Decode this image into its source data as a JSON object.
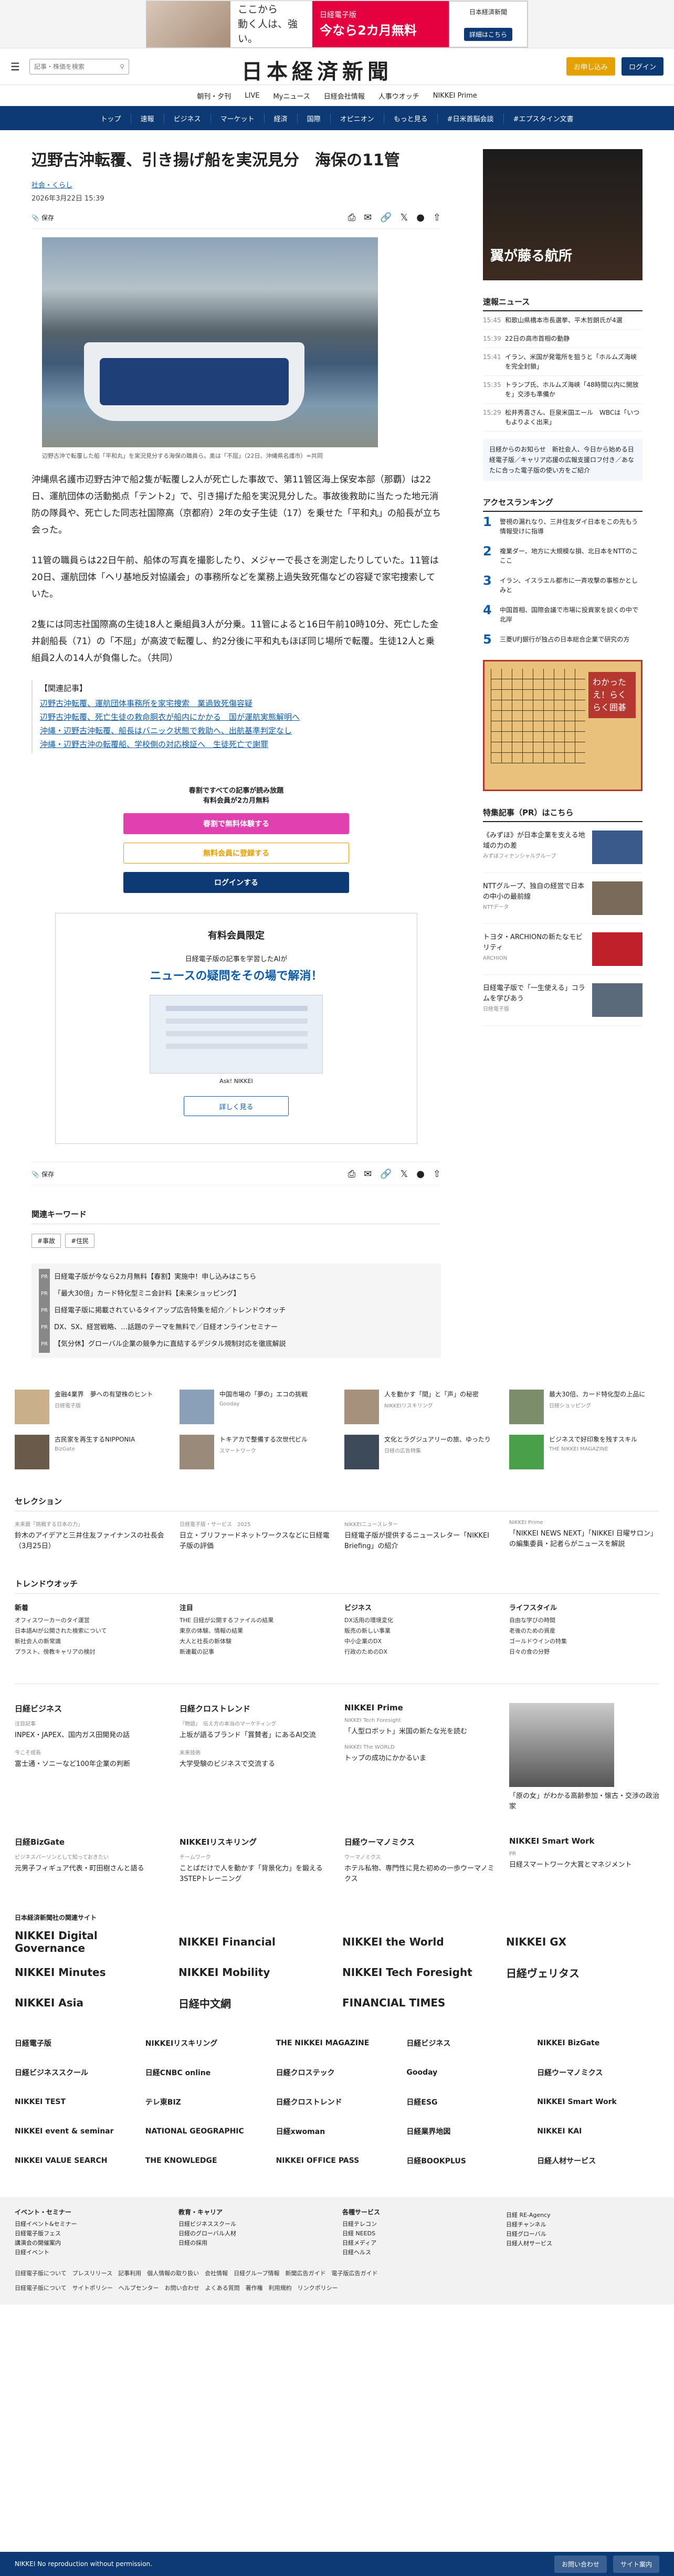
{
  "ad_top": {
    "line1": "ここから",
    "line2": "動く人は、強い。",
    "brand": "日経電子版",
    "offer": "今なら2カ月無料",
    "right_brand": "日本経済新聞",
    "cta": "詳細はこちら"
  },
  "header": {
    "search_placeholder": "記事・株価を検索",
    "logo": "日本経済新聞",
    "trial": "お申し込み",
    "login": "ログイン"
  },
  "subnav": [
    "朝刊・夕刊",
    "LIVE",
    "Myニュース",
    "日経会社情報",
    "人事ウオッチ",
    "NIKKEI Prime"
  ],
  "gnav": [
    "トップ",
    "速報",
    "ビジネス",
    "マーケット",
    "経済",
    "国際",
    "オピニオン",
    "もっと見る",
    "#日米首脳会談",
    "#エプスタイン文書"
  ],
  "article": {
    "title": "辺野古沖転覆、引き揚げ船を実況見分　海保の11管",
    "category": "社会・くらし",
    "date": "2026年3月22日 15:39",
    "save": "保存",
    "caption": "辺野古沖で転覆した船「平和丸」を実況見分する海保の職員ら。奥は「不屈」（22日、沖縄県名護市）=共同",
    "paragraphs": [
      "沖縄県名護市辺野古沖で船2隻が転覆し2人が死亡した事故で、第11管区海上保安本部（那覇）は22日、運航団体の活動拠点「テント2」で、引き揚げた船を実況見分した。事故後救助に当たった地元消防の隊員や、死亡した同志社国際高（京都府）2年の女子生徒（17）を乗せた「平和丸」の船長が立ち会った。",
      "11管の職員らは22日午前、船体の写真を撮影したり、メジャーで長さを測定したりしていた。11管は20日、運航団体「ヘリ基地反対協議会」の事務所などを業務上過失致死傷などの容疑で家宅捜索していた。",
      "2隻には同志社国際高の生徒18人と乗組員3人が分乗。11管によると16日午前10時10分、死亡した金井創船長（71）の「不屈」が高波で転覆し、約2分後に平和丸もほぼ同じ場所で転覆。生徒12人と乗組員2人の14人が負傷した。（共同）"
    ],
    "related_heading": "【関連記事】",
    "related": [
      "辺野古沖転覆、運航団体事務所を家宅捜索　業過致死傷容疑",
      "辺野古沖転覆、死亡生徒の救命胴衣が船内にかかる　国が運航実態解明へ",
      "沖縄・辺野古沖転覆、船長はバニック状態で救助へ、出航基準判定なし",
      "沖縄・辺野古沖の転覆船、学校側の対応検証へ　生徒死亡で謝罪"
    ]
  },
  "paywall": {
    "t1": "春割ですべての記事が読み放題",
    "t2": "有料会員が2カ月無料",
    "b1": "春割で無料体験する",
    "b2": "無料会員に登録する",
    "b3": "ログインする"
  },
  "member": {
    "h": "有料会員限定",
    "s": "日経電子版の記事を学習したAIが",
    "s2": "ニュースの疑問をその場で解消！",
    "ask": "Ask! NIKKEI",
    "more": "詳しく見る"
  },
  "keywords": {
    "h": "関連キーワード",
    "tags": [
      "#事故",
      "#住民"
    ]
  },
  "pr": [
    "日経電子版が今なら2カ月無料【春割】実施中！申し込みはこちら",
    "「最大30倍」カード特化型ミニ会計料【未来ショッピング】",
    "日経電子版に掲載されているタイアップ広告特集を紹介／トレンドウオッチ",
    "DX、SX、経営戦略、…話題のテーマを無料で／日経オンラインセミナー",
    "【気分休】グローバル企業の競争力に直結するデジタル規制対応を徹底解説"
  ],
  "side": {
    "ad_title": "翼が藤る航所",
    "news_h": "速報ニュース",
    "news": [
      [
        "15:45",
        "和歌山県橋本市長選挙、平木哲朗氏が4選"
      ],
      [
        "15:39",
        "22日の高市首相の動静"
      ],
      [
        "15:41",
        "イラン、米国が発電所を狙うと「ホルムズ海峡を完全封鎖」"
      ],
      [
        "15:35",
        "トランプ氏、ホルムズ海峡「48時間以内に開放を」交渉も準備か"
      ],
      [
        "15:29",
        "松井秀喜さん、巨泉米国エール　WBCは「いつもよりよく出来」"
      ]
    ],
    "nl": "日経からのお知らせ　新社会人、今日から始める日経電子版／キャリア応援の広報支援ロフ付き／あなたに合った電子版の使い方をご紹介",
    "rank_h": "アクセスランキング",
    "rank": [
      "警視の漏れなり、三井住友ダイ日本をこの先もう情報受けに指導",
      "複業ダー、地方に大規模な損、北日本をNTTのこここ",
      "イラン、イスラエル都市に一斉攻撃の事態かとしみと",
      "中国首相、国際会議で市場に投資家を説くの中で北岸",
      "三菱UFJ銀行が独占の日本総合企業で研究の方"
    ],
    "go_txt": "わかったえ！らくらく囲碁",
    "feat_h": "特集記事（PR）はこちら",
    "feat": [
      [
        "《みずほ》が日本企業を支える地域の力の差",
        "みずほフィナンシャルグループ"
      ],
      [
        "NTTグループ、独自の経営で日本の中小の最前線",
        "NTTデータ"
      ],
      [
        "トヨタ・ARCHIONの新たなモビリティ",
        "ARCHION"
      ],
      [
        "日経電子版で「一生使える」コラムを学びあう",
        "日経電子版"
      ]
    ]
  },
  "cards": [
    [
      "金融4業界　夢への有望株のヒント",
      "日経電子版"
    ],
    [
      "中国市場の「夢の」エコの挑戦",
      "Gooday"
    ],
    [
      "人を動かす「間」と「声」の秘密",
      "NIKKEIリスキリング"
    ],
    [
      "最大30倍、カード特化型の上品に",
      "日経ショッピング"
    ],
    [
      "古民家を再生するNIPPONIA",
      "BizGate"
    ],
    [
      "トキアカで整備する次世代ビル",
      "スマートワーク"
    ],
    [
      "文化とラグジュアリーの旅、ゆったり",
      "日経の広告特集"
    ],
    [
      "ビジネスで好印象を残すスキル",
      "THE NIKKEI MAGAZINE"
    ]
  ],
  "selection": {
    "h": "セレクション",
    "items": [
      [
        "未来面「挑戦する日本の力」",
        "鈴木のアイデアと三井住友ファイナンスの社長会（3月25日）"
      ],
      [
        "日経電子版・サービス　2025",
        "日立・ブリファードネットワークスなどに日経電子版の評価"
      ],
      [
        "NIKKEIニュースレター",
        "日経電子版が提供するニュースレター「NIKKEI Briefing」の紹介"
      ],
      [
        "NIKKEI Prime",
        "「NIKKEI NEWS NEXT」「NIKKEI 日曜サロン」の編集委員・記者らがニュースを解説"
      ]
    ]
  },
  "trend": {
    "h": "トレンドウオッチ",
    "cols": [
      [
        "新着",
        [
          "オフィスワーカーのタイ運営",
          "日本語AIが公開された検索について",
          "新社会人の新常識",
          "プラスト、傍教キャリアの検討"
        ]
      ],
      [
        "注目",
        [
          "THE 日経が公開するファイルの結果",
          "東京の体験、情報の結果",
          "大人と社長の新体験",
          "新連載の記事"
        ]
      ],
      [
        "ビジネス",
        [
          "DX活用の環境変化",
          "販売の新しい事業",
          "中小企業のDX",
          "行政のためのDX"
        ]
      ],
      [
        "ライフスタイル",
        [
          "自由な学びの時間",
          "老後のための資産",
          "ゴールドウインの特集",
          "日々の食の分野"
        ]
      ]
    ]
  },
  "blocks": [
    {
      "h": "日経ビジネス",
      "items": [
        [
          "注目記事",
          "INPEX・JAPEX、国内ガス田開発の話"
        ],
        [
          "今こそ成長",
          "富士通・ソニーなど100年企業の判断"
        ]
      ]
    },
    {
      "h": "日経クロストレンド",
      "items": [
        [
          "『物語』　伝え方の本当のマーケティング",
          "上坂が語るブランド「賞賛者」にあるAI交流"
        ],
        [
          "未来技術",
          "大学受験のビジネスで交流する"
        ]
      ]
    },
    {
      "h": "NIKKEI Prime",
      "items": [
        [
          "NIKKEI Tech Foresight",
          "「人型ロボット」米国の新たな光を読む"
        ],
        [
          "NIKKEI The WORLD",
          "トップの成功にかかるいま"
        ]
      ]
    },
    {
      "h": "日経BizGate",
      "items": [
        [
          "ビジネスパーソンとして知っておきたい",
          "元男子フィギュア代表・町田樹さんと語る"
        ]
      ]
    },
    {
      "h": "NIKKEIリスキリング",
      "items": [
        [
          "チームワーク",
          "ことばだけで人を動かす「背景化力」を鍛える3STEPトレーニング"
        ]
      ]
    },
    {
      "h": "日経ウーマノミクス",
      "items": [
        [
          "ウーマノミクス",
          "ホテル私物、専門性に見た初めの一歩ウーマノミクス"
        ]
      ]
    },
    {
      "h": "NIKKEI Smart Work",
      "items": [
        [
          "PR",
          "日経スマートワーク大賞とマネジメント"
        ]
      ]
    }
  ],
  "prime_photo_caption": "「原の女」がわかる高齢参加・懐古・交渉の政治家",
  "group": {
    "h": "日本経済新聞社の関連サイト",
    "logos": [
      "NIKKEI Digital Governance",
      "NIKKEI Financial",
      "NIKKEI the World",
      "NIKKEI GX",
      "NIKKEI Minutes",
      "NIKKEI Mobility",
      "NIKKEI Tech Foresight",
      "日経ヴェリタス",
      "NIKKEI Asia",
      "日経中文網",
      "FINANCIAL TIMES"
    ]
  },
  "group2": [
    "日経電子版",
    "NIKKEIリスキリング",
    "THE NIKKEI MAGAZINE",
    "日経ビジネス",
    "NIKKEI BizGate",
    "日経ビジネススクール",
    "日経CNBC online",
    "日経クロステック",
    "Gooday",
    "日経ウーマノミクス",
    "NIKKEI TEST",
    "テレ東BIZ",
    "日経クロストレンド",
    "日経ESG",
    "NIKKEI Smart Work",
    "NIKKEI event & seminar",
    "NATIONAL GEOGRAPHIC",
    "日経xwoman",
    "日経業界地図",
    "NIKKEI KAI",
    "NIKKEI VALUE SEARCH",
    "THE KNOWLEDGE",
    "NIKKEI OFFICE PASS",
    "日経BOOKPLUS",
    "日経人材サービス"
  ],
  "footer": {
    "cols": [
      [
        "イベント・セミナー",
        [
          "日経イベント&セミナー",
          "日経電子版フェス",
          "講演会の開催案内",
          "日経イベント"
        ]
      ],
      [
        "教育・キャリア",
        [
          "日経ビジネススクール",
          "日経のグローバル人材",
          "日経の採用"
        ]
      ],
      [
        "各種サービス",
        [
          "日経テレコン",
          "日経 NEEDS",
          "日経メディア",
          "日経ヘルス"
        ]
      ],
      [
        "",
        [
          "日経 RE-Agency",
          "日経チャンネル",
          "日経グローバル",
          "日経人材サービス"
        ]
      ]
    ],
    "links1": "日経電子版について　プレスリリース　記事利用　個人情報の取り扱い　会社情報　日経グループ情報　新聞広告ガイド　電子版広告ガイド",
    "links2": "日経電子版について　サイトポリシー　ヘルプセンター　お問い合わせ　よくある質問　著作権　利用規約　リンクポリシー",
    "fb": "NIKKEI  No reproduction without permission.",
    "btn1": "お問い合わせ",
    "btn2": "サイト案内"
  }
}
